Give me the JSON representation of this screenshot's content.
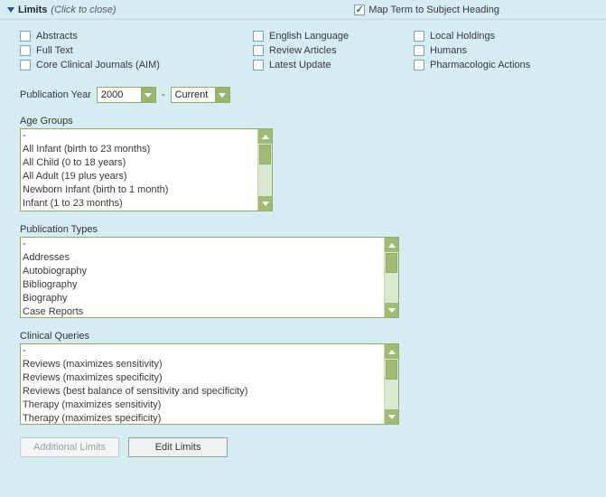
{
  "header": {
    "title": "Limits",
    "hint": "(Click to close)",
    "map_label": "Map Term to Subject Heading",
    "map_checked": true
  },
  "options": {
    "col1": [
      "Abstracts",
      "Full Text",
      "Core Clinical Journals (AIM)"
    ],
    "col2": [
      "English Language",
      "Review Articles",
      "Latest Update"
    ],
    "col3": [
      "Local Holdings",
      "Humans",
      "Pharmacologic Actions"
    ]
  },
  "pubyear": {
    "label": "Publication Year",
    "from": "2000",
    "dash": "-",
    "to": "Current"
  },
  "age_groups": {
    "label": "Age Groups",
    "items": [
      "-",
      "All Infant (birth to 23 months)",
      "All Child (0 to 18 years)",
      "All Adult (19 plus years)",
      "Newborn Infant (birth to 1 month)",
      "Infant (1 to 23 months)"
    ]
  },
  "pub_types": {
    "label": "Publication Types",
    "items": [
      "-",
      "Addresses",
      "Autobiography",
      "Bibliography",
      "Biography",
      "Case Reports"
    ]
  },
  "clinical_queries": {
    "label": "Clinical Queries",
    "items": [
      "-",
      "Reviews (maximizes sensitivity)",
      "Reviews (maximizes specificity)",
      "Reviews (best balance of sensitivity and specificity)",
      "Therapy (maximizes sensitivity)",
      "Therapy (maximizes specificity)"
    ]
  },
  "buttons": {
    "additional": "Additional Limits",
    "edit": "Edit Limits"
  }
}
